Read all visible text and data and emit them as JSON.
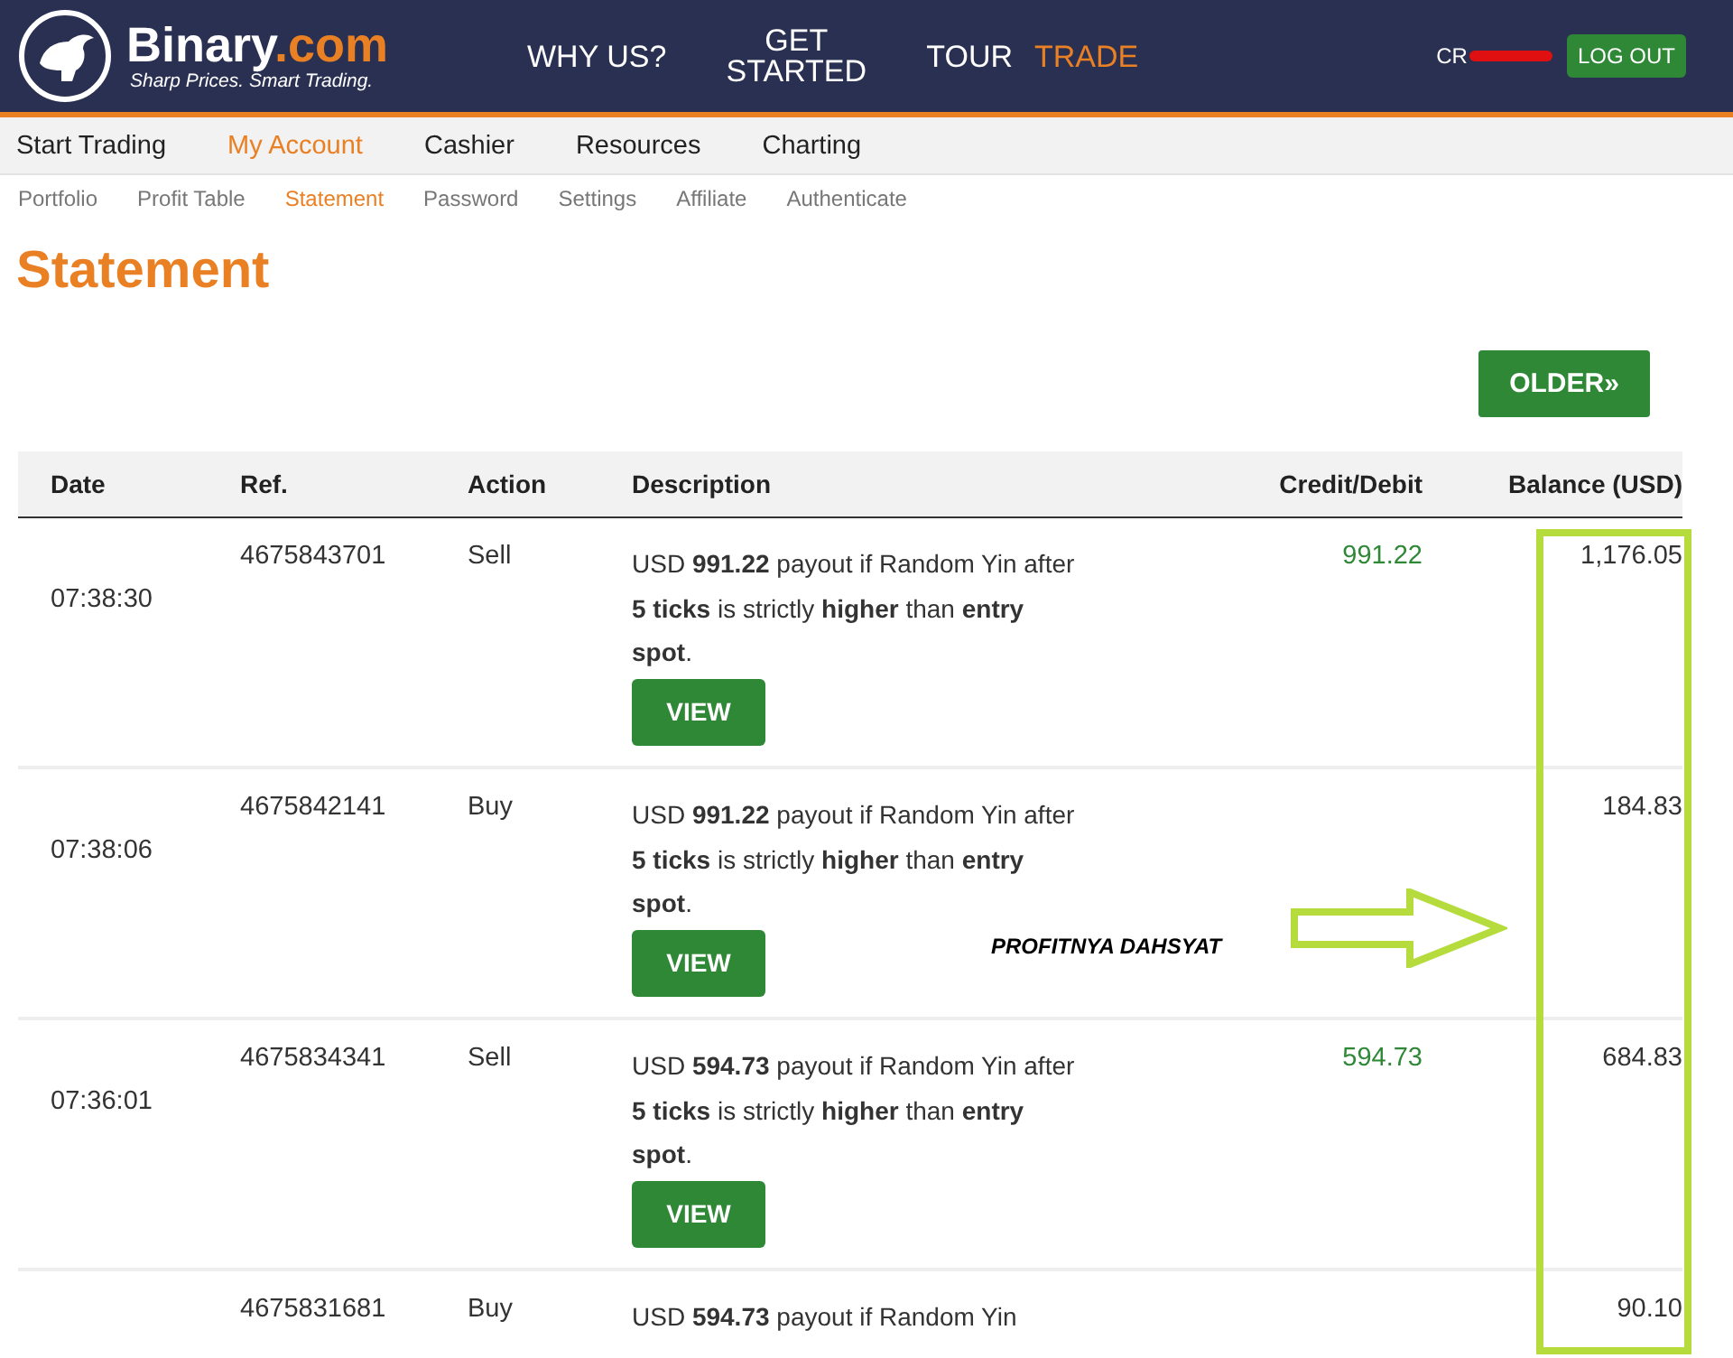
{
  "header": {
    "brand": "Binary",
    "brand_suffix": ".com",
    "tagline": "Sharp Prices. Smart Trading.",
    "nav": [
      {
        "label": "WHY US?",
        "selected": false
      },
      {
        "label": "GET STARTED",
        "selected": false
      },
      {
        "label": "TOUR",
        "selected": false
      },
      {
        "label": "TRADE",
        "selected": true
      }
    ],
    "account": "CR",
    "logout": "LOG OUT"
  },
  "menu": [
    {
      "label": "Start Trading",
      "selected": false
    },
    {
      "label": "My Account",
      "selected": true
    },
    {
      "label": "Cashier",
      "selected": false
    },
    {
      "label": "Resources",
      "selected": false
    },
    {
      "label": "Charting",
      "selected": false
    }
  ],
  "submenu": [
    {
      "label": "Portfolio",
      "selected": false
    },
    {
      "label": "Profit Table",
      "selected": false
    },
    {
      "label": "Statement",
      "selected": true
    },
    {
      "label": "Password",
      "selected": false
    },
    {
      "label": "Settings",
      "selected": false
    },
    {
      "label": "Affiliate",
      "selected": false
    },
    {
      "label": "Authenticate",
      "selected": false
    }
  ],
  "title": "Statement",
  "older_button": "OLDER»",
  "table": {
    "columns": [
      "Date",
      "Ref.",
      "Action",
      "Description",
      "Credit/Debit",
      "Balance (USD)"
    ],
    "rows": [
      {
        "time": "07:38:30",
        "ref": "4675843701",
        "action": "Sell",
        "description": "USD **991.22** payout if Random Yin after **5 ticks** is strictly **higher** than **entry spot**.",
        "credit": "991.22",
        "balance": "1,176.05",
        "button": "VIEW"
      },
      {
        "time": "07:38:06",
        "ref": "4675842141",
        "action": "Buy",
        "description": "USD **991.22** payout if Random Yin after **5 ticks** is strictly **higher** than **entry spot**.",
        "balance": "184.83",
        "button": "VIEW"
      },
      {
        "time": "07:36:01",
        "ref": "4675834341",
        "action": "Sell",
        "description": "USD **594.73** payout if Random Yin after **5 ticks** is strictly **higher** than **entry spot**.",
        "credit": "594.73",
        "balance": "684.83",
        "button": "VIEW"
      },
      {
        "ref": "4675831681",
        "action": "Buy",
        "description": "USD **594.73** payout if Random Yin",
        "balance": "90.10"
      }
    ]
  },
  "annotation": {
    "text": "PROFITNYA DAHSYAT"
  }
}
